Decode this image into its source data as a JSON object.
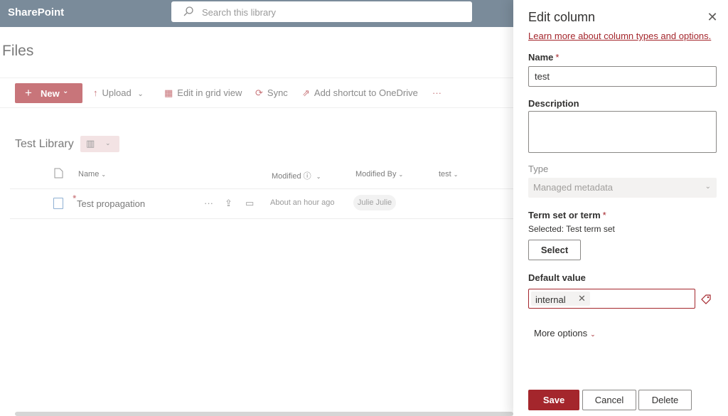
{
  "suitebar": {
    "brand": "SharePoint",
    "search_placeholder": "Search this library"
  },
  "page": {
    "title": "Files"
  },
  "commandbar": {
    "new_label": "New",
    "upload_label": "Upload",
    "grid_label": "Edit in grid view",
    "sync_label": "Sync",
    "shortcut_label": "Add shortcut to OneDrive",
    "more_label": "···"
  },
  "library": {
    "title": "Test Library",
    "columns": {
      "name": "Name",
      "modified": "Modified",
      "modified_by": "Modified By",
      "test": "test"
    },
    "rows": [
      {
        "name": "Test propagation",
        "modified": "About an hour ago",
        "modified_by": "Julie Julie"
      }
    ]
  },
  "panel": {
    "title": "Edit column",
    "learn_link": "Learn more about column types and options.",
    "name_label": "Name",
    "required_marker": "*",
    "name_value": "test",
    "description_label": "Description",
    "description_value": "",
    "type_label": "Type",
    "type_value": "Managed metadata",
    "termset_label": "Term set or term",
    "selected_prefix": "Selected:",
    "selected_value": "Test term set",
    "select_button": "Select",
    "default_label": "Default value",
    "default_tag": "internal",
    "more_options": "More options",
    "save_button": "Save",
    "cancel_button": "Cancel",
    "delete_button": "Delete"
  },
  "colors": {
    "accent": "#a4262c",
    "suitebar": "#7a8b9a"
  }
}
